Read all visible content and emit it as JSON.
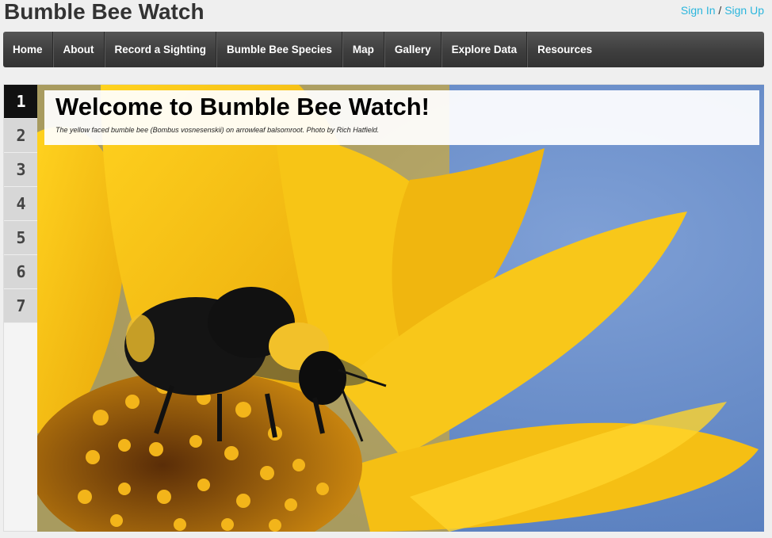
{
  "site": {
    "title": "Bumble Bee Watch"
  },
  "auth": {
    "sign_in": "Sign In",
    "separator": "/",
    "sign_up": "Sign Up"
  },
  "nav": {
    "items": [
      {
        "label": "Home"
      },
      {
        "label": "About"
      },
      {
        "label": "Record a Sighting"
      },
      {
        "label": "Bumble Bee Species"
      },
      {
        "label": "Map"
      },
      {
        "label": "Gallery"
      },
      {
        "label": "Explore Data"
      },
      {
        "label": "Resources"
      }
    ]
  },
  "slider": {
    "tabs": [
      "1",
      "2",
      "3",
      "4",
      "5",
      "6",
      "7"
    ],
    "active_tab": "1",
    "slide": {
      "title": "Welcome to Bumble Bee Watch!",
      "caption": "The yellow faced bumble bee (Bombus vosnesenskii) on arrowleaf balsomroot. Photo by Rich Hatfield."
    }
  },
  "colors": {
    "link": "#2bb6dd",
    "nav_bg": "#3e3e3e",
    "active_tab": "#111111",
    "petal": "#f5c518",
    "sky": "#6d92cc"
  }
}
